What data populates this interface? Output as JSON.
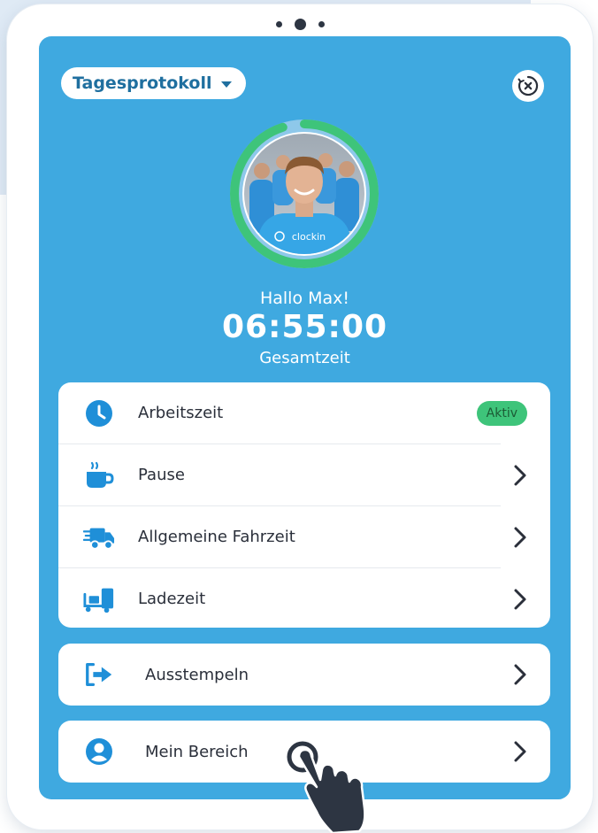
{
  "header": {
    "protocol_dropdown": "Tagesprotokoll"
  },
  "user": {
    "greeting": "Hallo Max!",
    "total_time": "06:55:00",
    "total_label": "Gesamtzeit",
    "shirt_brand": "clockin",
    "progress_fraction": 0.95
  },
  "menu": {
    "items": [
      {
        "label": "Arbeitszeit",
        "icon": "clock-icon",
        "badge": "Aktiv"
      },
      {
        "label": "Pause",
        "icon": "coffee-icon"
      },
      {
        "label": "Allgemeine Fahrzeit",
        "icon": "truck-icon"
      },
      {
        "label": "Ladezeit",
        "icon": "loading-icon"
      }
    ]
  },
  "actions": {
    "clock_out": "Ausstempeln",
    "my_area": "Mein Bereich"
  },
  "colors": {
    "screen": "#3fa9e0",
    "accent_green": "#3ec47a",
    "icon_blue": "#1f8fd8",
    "text_dark": "#2a2f3a"
  }
}
